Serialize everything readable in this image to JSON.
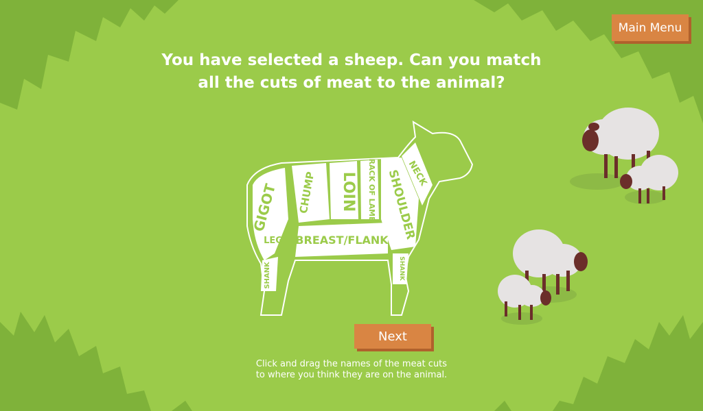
{
  "header": {
    "title_line1": "You have selected a sheep. Can you match",
    "title_line2": "all the cuts of meat to the animal?"
  },
  "menu": {
    "main_menu_label": "Main Menu"
  },
  "actions": {
    "next_label": "Next"
  },
  "instructions": {
    "line1": "Click and drag the names of the meat cuts",
    "line2": "to where you think they are on the animal."
  },
  "sheep_diagram": {
    "cuts": {
      "gigot": "GIGOT",
      "leg": "LEG",
      "shank_rear": "SHANK",
      "chump": "CHUMP",
      "loin": "LOIN",
      "rack": "RACK OF LAMB",
      "shoulder": "SHOULDER",
      "neck": "NECK",
      "breast": "BREAST/FLANK",
      "shank_front": "SHANK"
    }
  },
  "colors": {
    "background": "#9bcb4a",
    "grass_dark": "#7fb23a",
    "button": "#d98543",
    "button_shadow": "#b0612c",
    "sheep_wool": "#e6e3e3",
    "sheep_face": "#6b2e2a"
  }
}
